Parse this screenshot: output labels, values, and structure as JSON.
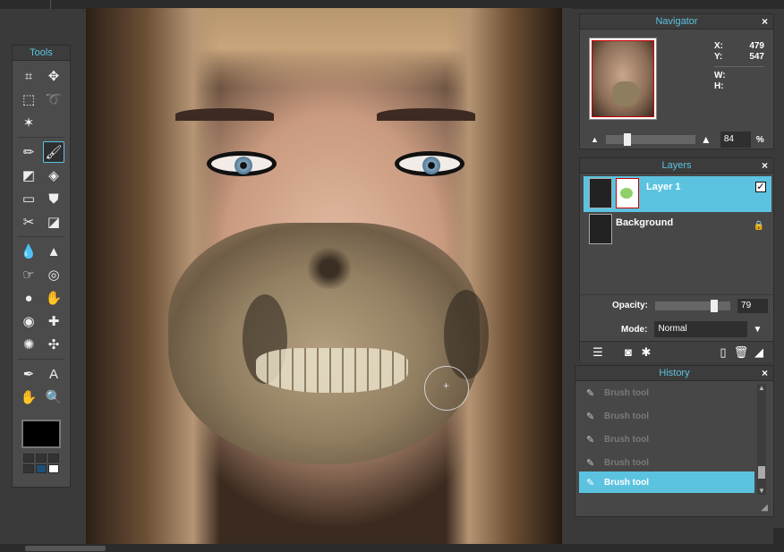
{
  "tools_panel": {
    "title": "Tools",
    "rows": [
      [
        {
          "name": "crop-tool",
          "glyph": "⌗"
        },
        {
          "name": "move-tool",
          "glyph": "✥"
        }
      ],
      [
        {
          "name": "marquee-tool",
          "glyph": "⬚"
        },
        {
          "name": "lasso-tool",
          "glyph": "➰"
        }
      ],
      [
        {
          "name": "magic-wand-tool",
          "glyph": "✶"
        },
        {
          "name": "empty-slot",
          "glyph": ""
        }
      ],
      [
        {
          "name": "pencil-tool",
          "glyph": "✏"
        },
        {
          "name": "brush-tool",
          "glyph": "🖌"
        }
      ],
      [
        {
          "name": "eraser-tool",
          "glyph": "◩"
        },
        {
          "name": "paint-bucket-tool",
          "glyph": "◈"
        }
      ],
      [
        {
          "name": "gradient-tool",
          "glyph": "▭"
        },
        {
          "name": "clone-stamp-tool",
          "glyph": "⛊"
        }
      ],
      [
        {
          "name": "color-replace-tool",
          "glyph": "✂"
        },
        {
          "name": "shape-tool",
          "glyph": "◪"
        }
      ],
      [
        {
          "name": "blur-tool",
          "glyph": "💧"
        },
        {
          "name": "sharpen-tool",
          "glyph": "▲"
        }
      ],
      [
        {
          "name": "smudge-tool",
          "glyph": "☞"
        },
        {
          "name": "sponge-tool",
          "glyph": "◎"
        }
      ],
      [
        {
          "name": "dodge-tool",
          "glyph": "●"
        },
        {
          "name": "burn-tool",
          "glyph": "✋"
        }
      ],
      [
        {
          "name": "red-eye-tool",
          "glyph": "◉"
        },
        {
          "name": "spot-heal-tool",
          "glyph": "✚"
        }
      ],
      [
        {
          "name": "bloat-tool",
          "glyph": "✺"
        },
        {
          "name": "pinch-tool",
          "glyph": "✣"
        }
      ],
      [
        {
          "name": "color-picker-tool",
          "glyph": "✒"
        },
        {
          "name": "type-tool",
          "glyph": "A"
        }
      ],
      [
        {
          "name": "hand-tool",
          "glyph": "✋"
        },
        {
          "name": "zoom-tool",
          "glyph": "🔍"
        }
      ]
    ]
  },
  "navigator": {
    "title": "Navigator",
    "close": "×",
    "x_label": "X:",
    "x_value": "479",
    "y_label": "Y:",
    "y_value": "547",
    "w_label": "W:",
    "w_value": "",
    "h_label": "H:",
    "h_value": "",
    "zoom_value": "84",
    "zoom_unit": "%"
  },
  "layers": {
    "title": "Layers",
    "close": "×",
    "items": [
      {
        "name": "Layer 1",
        "selected": true,
        "visible_check": "✓"
      },
      {
        "name": "Background",
        "selected": false,
        "lock": "🔒"
      }
    ],
    "opacity_label": "Opacity:",
    "opacity_value": "79",
    "opacity_level": 0.79,
    "mode_label": "Mode:",
    "mode_value": "Normal"
  },
  "history": {
    "title": "History",
    "close": "×",
    "items": [
      {
        "label": "Brush tool",
        "selected": false
      },
      {
        "label": "Brush tool",
        "selected": false
      },
      {
        "label": "Brush tool",
        "selected": false
      },
      {
        "label": "Brush tool",
        "selected": false
      },
      {
        "label": "Brush tool",
        "selected": true
      }
    ]
  },
  "colors": {
    "accent": "#5bc3e0",
    "foreground": "#000000",
    "panel": "#474747"
  }
}
